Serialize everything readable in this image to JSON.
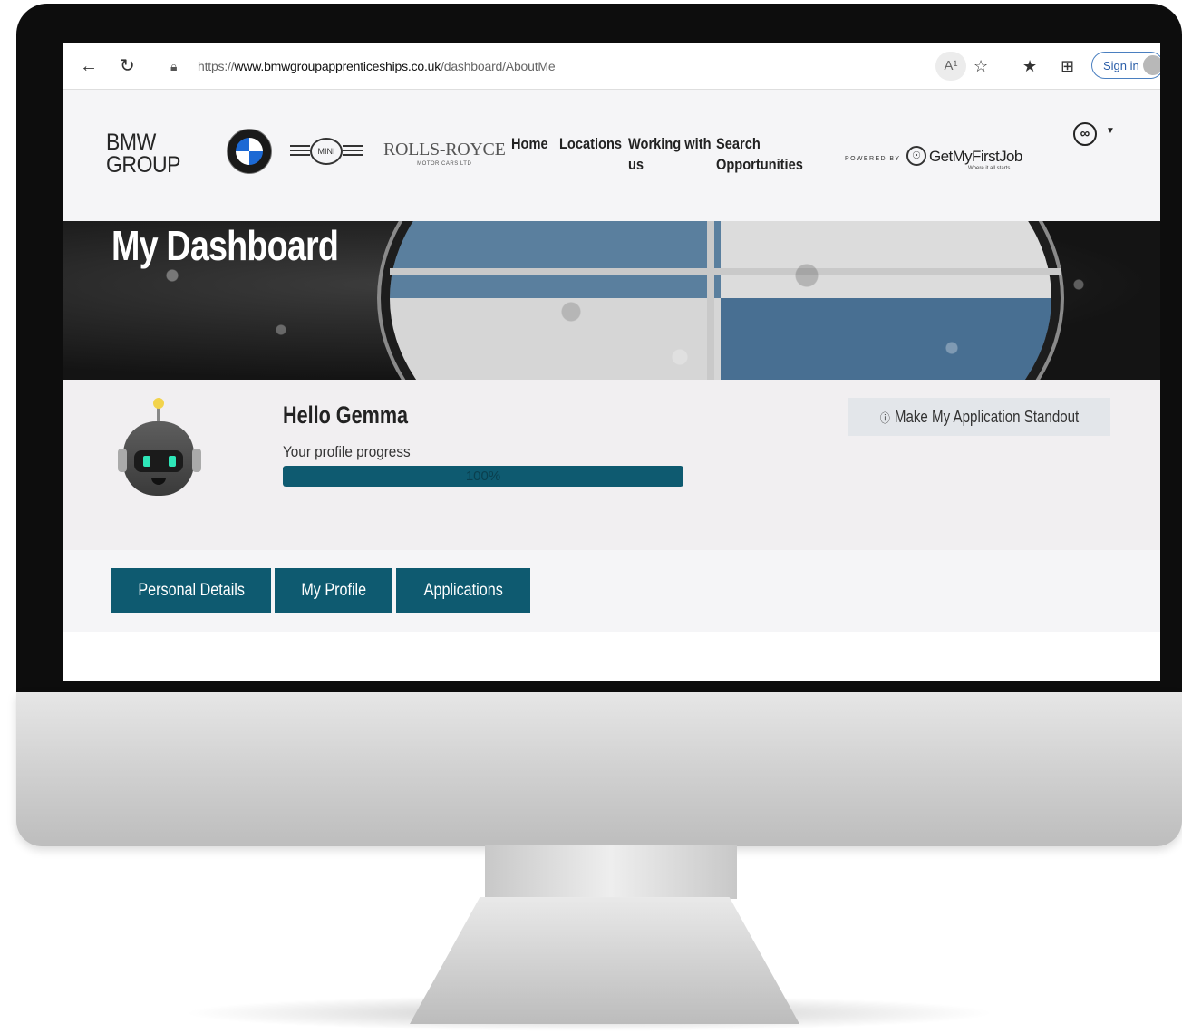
{
  "browser": {
    "url_prefix": "https://",
    "url_host": "www.bmwgroupapprenticeships.co.uk",
    "url_path": "/dashboard/AboutMe",
    "sign_in_label": "Sign in",
    "read_aloud_label": "A¹"
  },
  "header": {
    "bmw_group_line1": "BMW",
    "bmw_group_line2": "GROUP",
    "bmw_roundel_letters": "B M W",
    "mini_label": "MINI",
    "rolls_royce_name": "ROLLS-ROYCE",
    "rolls_royce_sub": "MOTOR CARS LTD",
    "nav": [
      {
        "label_line1": "Home",
        "label_line2": ""
      },
      {
        "label_line1": "Locations",
        "label_line2": ""
      },
      {
        "label_line1": "Working with",
        "label_line2": "us"
      },
      {
        "label_line1": "Search",
        "label_line2": "Opportunities"
      }
    ],
    "powered_by": "POWERED BY",
    "partner_name": "GetMyFirstJob",
    "partner_tagline": "Where it all starts."
  },
  "banner": {
    "title": "My Dashboard"
  },
  "profile": {
    "greeting": "Hello Gemma",
    "progress_label": "Your profile progress",
    "progress_percent": 100,
    "progress_text": "100%",
    "standout_label": "Make My Application Standout"
  },
  "tabs": [
    {
      "label": "Personal Details"
    },
    {
      "label": "My Profile"
    },
    {
      "label": "Applications"
    }
  ],
  "colors": {
    "brand_teal": "#0e5a70",
    "bmw_blue": "#1c69d4"
  }
}
